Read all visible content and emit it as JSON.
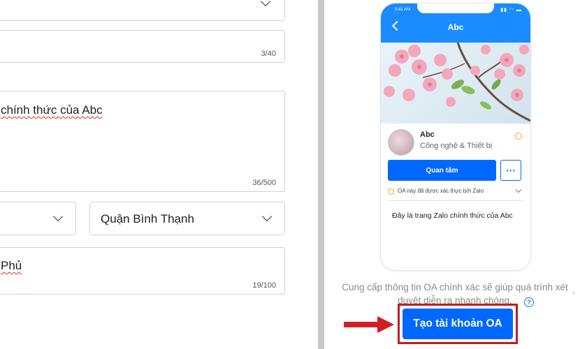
{
  "form": {
    "fields": [
      {
        "counter": ""
      },
      {
        "counter": "3/40"
      },
      {
        "value": "chính thức của Abc",
        "counter": "36/500"
      },
      {
        "value": ""
      },
      {
        "value": "Quận Bình Thạnh"
      },
      {
        "value": "Phủ",
        "counter": "19/100"
      }
    ]
  },
  "preview": {
    "status_time": "9:41 AM",
    "header_title": "Abc",
    "name": "Abc",
    "category": "Công nghệ & Thiết bị",
    "follow_label": "Quan tâm",
    "more_label": "···",
    "verified_text": "OA này đã được xác thực bởi Zalo",
    "description": "Đây là trang Zalo chính thức của Abc"
  },
  "info_text": "Cung cấp thông tin OA chính xác sẽ giúp quá trình xét duyệt diễn ra nhanh chóng.",
  "help_glyph": "?",
  "create_button_label": "Tạo tài khoản OA",
  "colors": {
    "brand_blue": "#0068ff",
    "header_blue": "#1a8cff",
    "highlight_red": "#c51a20",
    "arrow_red": "#d21f26",
    "verify_orange": "#f5a623"
  },
  "icons": [
    "chevron-down-icon",
    "back-arrow-icon",
    "verified-badge-icon",
    "more-icon",
    "help-icon",
    "arrow-right-icon"
  ]
}
